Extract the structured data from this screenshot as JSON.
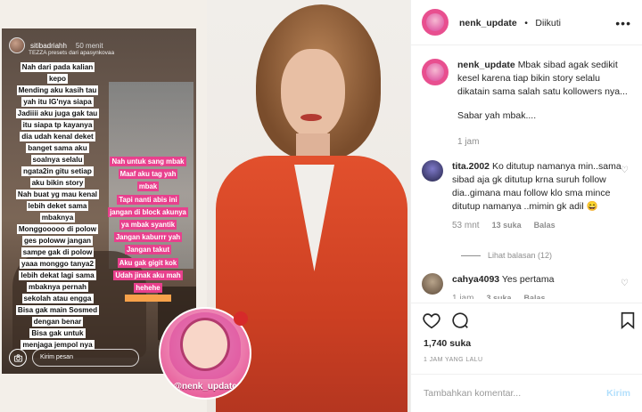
{
  "story": {
    "username": "sitibadriahh",
    "time": "50 menit",
    "presets": "TEZZA presets dari apasynkovaa",
    "left_lines": [
      "Nah dari pada kalian",
      "kepo",
      "Mending aku kasih tau",
      "yah itu IG'nya siapa",
      "Jadiiii aku juga gak tau",
      "itu siapa tp kayanya",
      "dia udah kenal deket",
      "banget sama aku",
      "soalnya selalu",
      "ngata2in gitu setiap",
      "aku bikin story",
      "Nah buat yg mau kenal",
      "lebih deket sama",
      "mbaknya",
      "Monggooooo di polow",
      "ges poloww jangan",
      "sampe gak di polow",
      "yaaa monggo tanya2",
      "lebih dekat lagi sama",
      "mbaknya pernah",
      "sekolah atau engga",
      "Bisa gak main Sosmed",
      "dengan benar",
      "Bisa gak untuk",
      "menjaga jempol nya"
    ],
    "right_lines": [
      "Nah untuk sang mbak",
      "Maaf aku tag yah",
      "mbak",
      "Tapi nanti abis ini",
      "jangan di block akunya",
      "ya mbak syantik",
      "Jangan kaburrr yah",
      "Jangan takut",
      "Aku gak gigit kok",
      "Udah jinak aku mah",
      "hehehe"
    ],
    "send_placeholder": "Kirim pesan",
    "camera_icon": "camera-icon"
  },
  "watermark": {
    "text": "@nenk_update"
  },
  "header": {
    "username": "nenk_update",
    "separator": "•",
    "follow_status": "Diikuti",
    "more_icon": "more-icon"
  },
  "caption": {
    "username": "nenk_update",
    "text": "Mbak sibad agak sedikit kesel karena tiap bikin story selalu dikatain sama salah satu kollowers nya...",
    "text2": "Sabar yah mbak....",
    "time": "1 jam"
  },
  "comments": [
    {
      "username": "tita.2002",
      "text": "Ko ditutup namanya min..sama sibad aja gk ditutup krna suruh follow dia..gimana mau follow klo sma mince ditutup namanya ..mimin gk adil 😄",
      "time": "53 mnt",
      "likes": "13 suka",
      "reply": "Balas",
      "avatar_color": "#3b3b6b"
    },
    {
      "username": "cahya4093",
      "text": "Yes pertama",
      "time": "1 jam",
      "likes": "3 suka",
      "reply": "Balas",
      "avatar_color": "#8a7560"
    }
  ],
  "view_replies": "Lihat balasan (12)",
  "likes_count": "1,740 suka",
  "time_ago": "1 JAM YANG LALU",
  "add_comment": {
    "placeholder": "Tambahkan komentar...",
    "post_label": "Kirim"
  }
}
